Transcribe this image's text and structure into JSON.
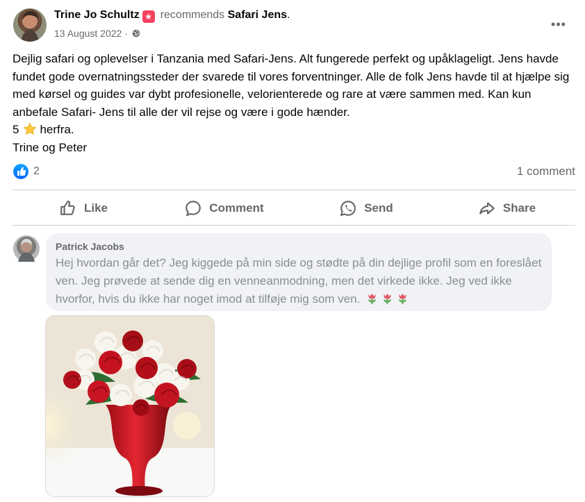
{
  "post": {
    "author": "Trine Jo Schultz",
    "verb": "recommends",
    "page": "Safari Jens",
    "period": ".",
    "date": "13 August 2022",
    "separator": "·",
    "more": "•••",
    "body": [
      "Dejlig safari og oplevelser i Tanzania med Safari-Jens. Alt fungerede perfekt og upåklageligt. Jens havde fundet gode overnatningssteder der svarede til vores forventninger. Alle de folk Jens havde til at hjælpe sig med kørsel og guides var dybt profesionelle, velorienterede og rare at være sammen med. Kan kun anbefale Safari- Jens til alle der vil rejse og være i gode hænder."
    ],
    "rating_number": "5",
    "rating_suffix": "herfra.",
    "signature": "Trine og Peter",
    "reaction_count": "2",
    "comment_count": "1 comment"
  },
  "actions": {
    "like": "Like",
    "comment": "Comment",
    "send": "Send",
    "share": "Share"
  },
  "comment": {
    "author": "Patrick Jacobs",
    "text": "Hej hvordan går det? Jeg kiggede på min side og stødte på din dejlige profil som en foreslået ven. Jeg prøvede at sende dig en venneanmodning, men det virkede ikke. Jeg ved ikke hvorfor, hvis du ikke har noget imod at tilføje mig som ven."
  },
  "icons": {
    "recommend": "recommend-star-icon",
    "globe": "globe-icon",
    "star": "star-emoji-icon",
    "like_reaction": "like-reaction-icon",
    "tulip": "tulip-emoji-icon"
  },
  "colors": {
    "primary_text": "#050505",
    "secondary_text": "#65676b",
    "faded_comment_text": "#8a8d91",
    "recommend_red": "#f3425f",
    "like_blue": "#0866ff",
    "comment_bubble": "#f0f2f5",
    "divider": "#ced0d4"
  }
}
